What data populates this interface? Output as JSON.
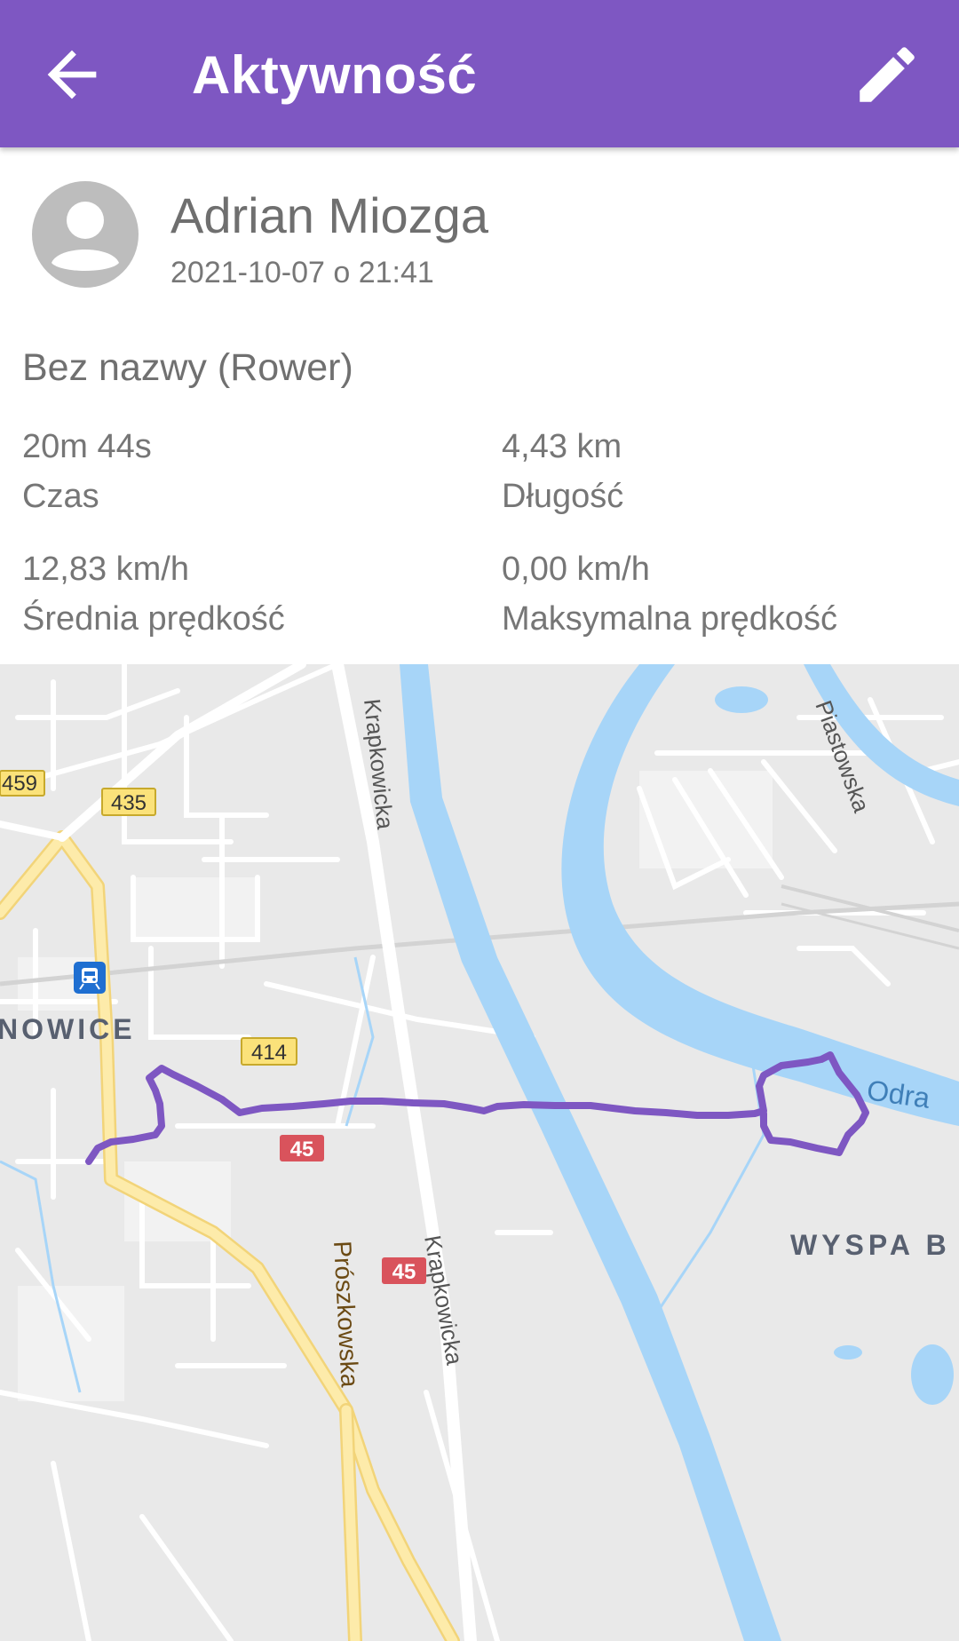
{
  "appbar": {
    "title": "Aktywność",
    "back_icon": "arrow-back-icon",
    "edit_icon": "edit-pencil-icon",
    "color": "#7e57c2"
  },
  "user": {
    "name": "Adrian Miozga",
    "datetime": "2021-10-07 o 21:41",
    "avatar_icon": "account-circle-icon"
  },
  "activity": {
    "title": "Bez nazwy (Rower)",
    "stats": [
      {
        "value": "20m 44s",
        "label": "Czas"
      },
      {
        "value": "4,43 km",
        "label": "Długość"
      },
      {
        "value": "12,83 km/h",
        "label": "Średnia prędkość"
      },
      {
        "value": "0,00 km/h",
        "label": "Maksymalna prędkość"
      }
    ]
  },
  "map": {
    "route_color": "#7e57c2",
    "water_color": "#a7d5f8",
    "labels": {
      "road_459": "459",
      "road_435": "435",
      "road_414": "414",
      "road_45_a": "45",
      "road_45_b": "45",
      "street_krapkowicka_1": "Krapkowicka",
      "street_krapkowicka_2": "Krapkowicka",
      "street_piastowska": "Piastowska",
      "street_proszkowska": "Prószkowska",
      "river": "Odra",
      "district_west": "NOWICE",
      "district_east": "WYSPA B"
    },
    "train_icon": "train-station-icon"
  }
}
